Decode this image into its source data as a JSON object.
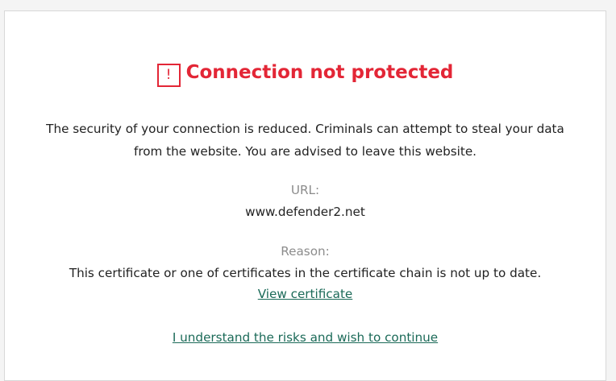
{
  "title": "Connection not protected",
  "warning_icon": {
    "glyph": "!",
    "name": "exclamation-icon"
  },
  "description": "The security of your connection is reduced. Criminals can attempt to steal your data from the website. You are advised to leave this website.",
  "url_section": {
    "label": "URL:",
    "value": "www.defender2.net"
  },
  "reason_section": {
    "label": "Reason:",
    "value": "This certificate or one of certificates in the certificate chain is not up to date."
  },
  "links": {
    "view_certificate": "View certificate",
    "continue": "I understand the risks and wish to continue"
  },
  "colors": {
    "title": "#e32636",
    "link": "#1b6a58",
    "label": "#8c8c8c",
    "text": "#222222"
  }
}
